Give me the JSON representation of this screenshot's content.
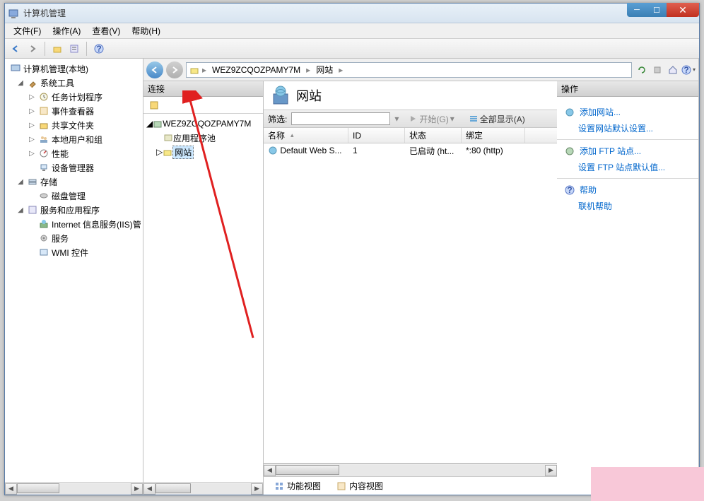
{
  "window": {
    "title": "计算机管理"
  },
  "menubar": [
    "文件(F)",
    "操作(A)",
    "查看(V)",
    "帮助(H)"
  ],
  "lefttree": {
    "root": "计算机管理(本地)",
    "g1": "系统工具",
    "g1_1": "任务计划程序",
    "g1_2": "事件查看器",
    "g1_3": "共享文件夹",
    "g1_4": "本地用户和组",
    "g1_5": "性能",
    "g1_6": "设备管理器",
    "g2": "存储",
    "g2_1": "磁盘管理",
    "g3": "服务和应用程序",
    "g3_1": "Internet 信息服务(IIS)管",
    "g3_2": "服务",
    "g3_3": "WMI 控件"
  },
  "breadcrumb": {
    "seg1": "WEZ9ZCQOZPAMY7M",
    "seg2": "网站"
  },
  "conn": {
    "header": "连接",
    "root": "WEZ9ZCQOZPAMY7M",
    "pool": "应用程序池",
    "sites": "网站"
  },
  "center": {
    "title": "网站",
    "filterLabel": "筛选:",
    "startLabel": "开始(G)",
    "showAllLabel": "全部显示(A)",
    "cols": {
      "name": "名称",
      "id": "ID",
      "status": "状态",
      "binding": "绑定"
    },
    "row": {
      "name": "Default Web S...",
      "id": "1",
      "status": "已启动 (ht...",
      "binding": "*:80 (http)"
    },
    "viewFeature": "功能视图",
    "viewContent": "内容视图"
  },
  "actions": {
    "header": "操作",
    "addSite": "添加网站...",
    "setDefaults": "设置网站默认设置...",
    "addFtp": "添加 FTP 站点...",
    "setFtpDefaults": "设置 FTP 站点默认值...",
    "help": "帮助",
    "onlineHelp": "联机帮助"
  }
}
